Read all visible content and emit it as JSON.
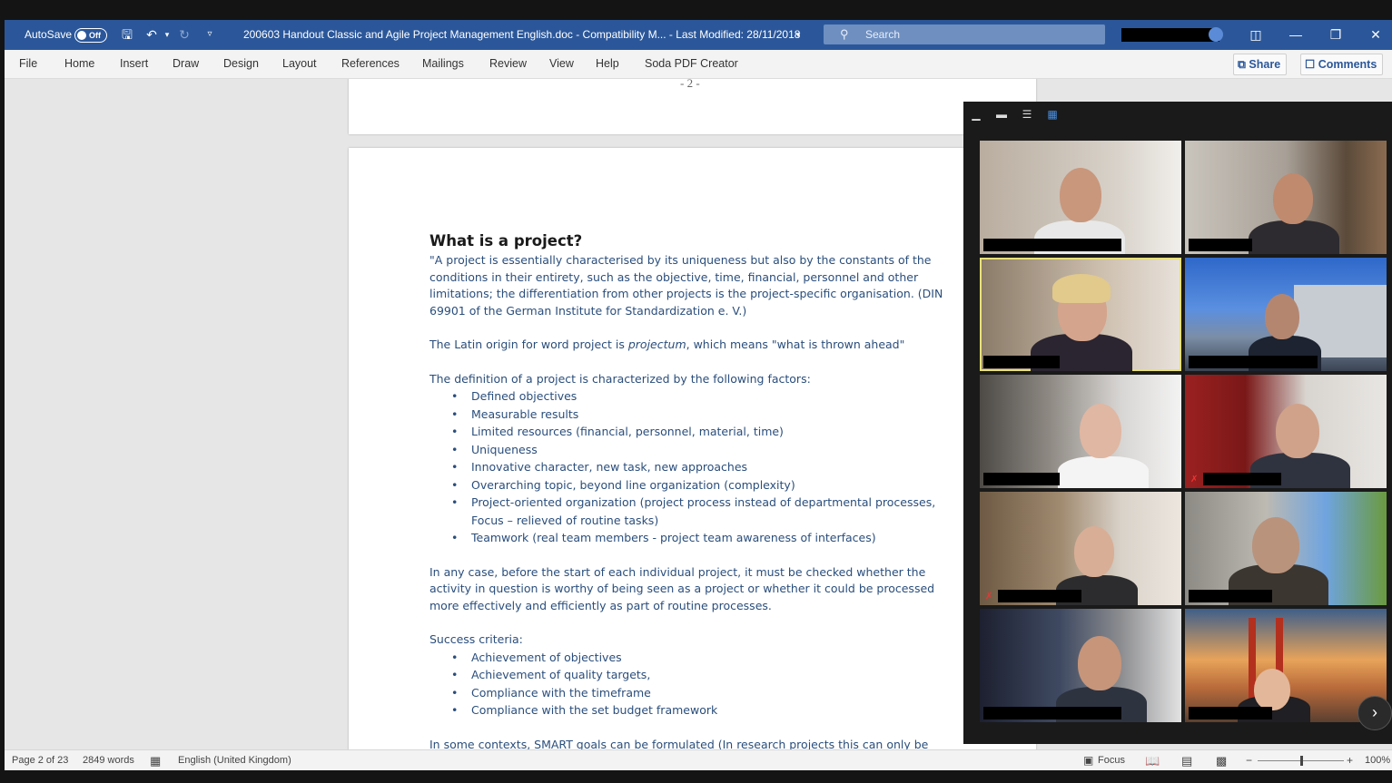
{
  "titlebar": {
    "autosave_label": "AutoSave",
    "autosave_state": "Off",
    "doc_title": "200603 Handout Classic and Agile Project Management English.doc  -  Compatibility M...  -  Last Modified: 28/11/2018",
    "search_placeholder": "Search",
    "bg_color": "#2b579a"
  },
  "menu": {
    "items": [
      "File",
      "Home",
      "Insert",
      "Draw",
      "Design",
      "Layout",
      "References",
      "Mailings",
      "Review",
      "View",
      "Help",
      "Soda PDF Creator"
    ],
    "share_label": "Share",
    "comments_label": "Comments"
  },
  "document": {
    "page_number": "- 2 -",
    "heading": "What is a project?",
    "quote": "\"A project is essentially characterised by its uniqueness but also by the constants of the conditions in their entirety, such as the objective, time, financial, personnel and other limitations; the differentiation from other projects is the project-specific organisation. (DIN 69901 of the German Institute for Standardization e. V.)",
    "latin_pre": "The Latin origin for word project is ",
    "latin_em": "projectum",
    "latin_post": ", which means \"what is thrown ahead\"",
    "definition_intro": "The definition of a project is characterized by the following factors:",
    "factors": [
      "Defined objectives",
      "Measurable results",
      "Limited resources (financial, personnel, material, time)",
      "Uniqueness",
      "Innovative character, new task, new approaches",
      "Overarching topic, beyond line organization (complexity)",
      "Project-oriented organization (project process instead of departmental processes, Focus – relieved of routine tasks)",
      "Teamwork (real team members - project team awareness of interfaces)"
    ],
    "check_paragraph": "In any case, before the start of each individual project, it must be checked whether the activity in question is worthy of being seen as a project or whether it could be processed more effectively and efficiently as part of routine processes.",
    "success_intro": "Success criteria:",
    "success_items": [
      "Achievement of objectives",
      "Achievement of quality targets,",
      "Compliance with the timeframe",
      "Compliance with the set budget framework"
    ],
    "trailing_line": "In some contexts, SMART goals can be formulated (In research projects this can only be"
  },
  "statusbar": {
    "page": "Page 2 of 23",
    "words": "2849 words",
    "language": "English (United Kingdom)",
    "focus_label": "Focus",
    "zoom_minus": "−",
    "zoom_plus": "+",
    "zoom_level": "100%",
    "zoom_fraction": 0.5
  },
  "zoom_call": {
    "layout": "gallery",
    "participants": 10,
    "active_speaker_index": 2,
    "muted_indices": [
      4,
      6
    ]
  }
}
